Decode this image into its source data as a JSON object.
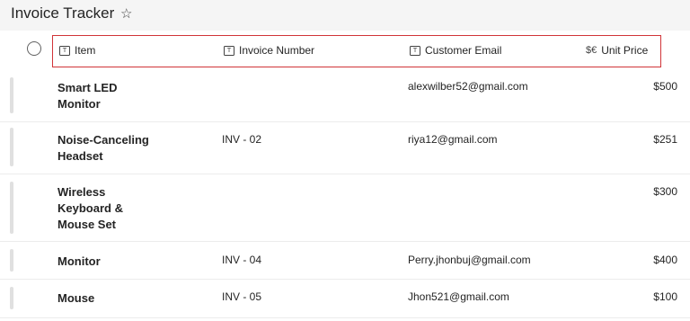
{
  "app": {
    "title": "Invoice Tracker",
    "favorite_icon": "star-icon"
  },
  "columns": [
    {
      "label": "Item",
      "icon": "text-column-icon"
    },
    {
      "label": "Invoice Number",
      "icon": "text-column-icon"
    },
    {
      "label": "Customer Email",
      "icon": "text-column-icon"
    },
    {
      "label": "Unit Price",
      "icon": "currency-column-icon"
    }
  ],
  "rows": [
    {
      "item": "Smart LED Monitor",
      "invoice_number": "",
      "email": "alexwilber52@gmail.com",
      "price": "$500"
    },
    {
      "item": "Noise-Canceling Headset",
      "invoice_number": "INV - 02",
      "email": "riya12@gmail.com",
      "price": "$251"
    },
    {
      "item": "Wireless Keyboard & Mouse Set",
      "invoice_number": "",
      "email": "",
      "price": "$300"
    },
    {
      "item": "Monitor",
      "invoice_number": "INV - 04",
      "email": "Perry.jhonbuj@gmail.com",
      "price": "$400"
    },
    {
      "item": "Mouse",
      "invoice_number": "INV - 05",
      "email": "Jhon521@gmail.com",
      "price": "$100"
    }
  ],
  "highlight_color": "#d13438"
}
